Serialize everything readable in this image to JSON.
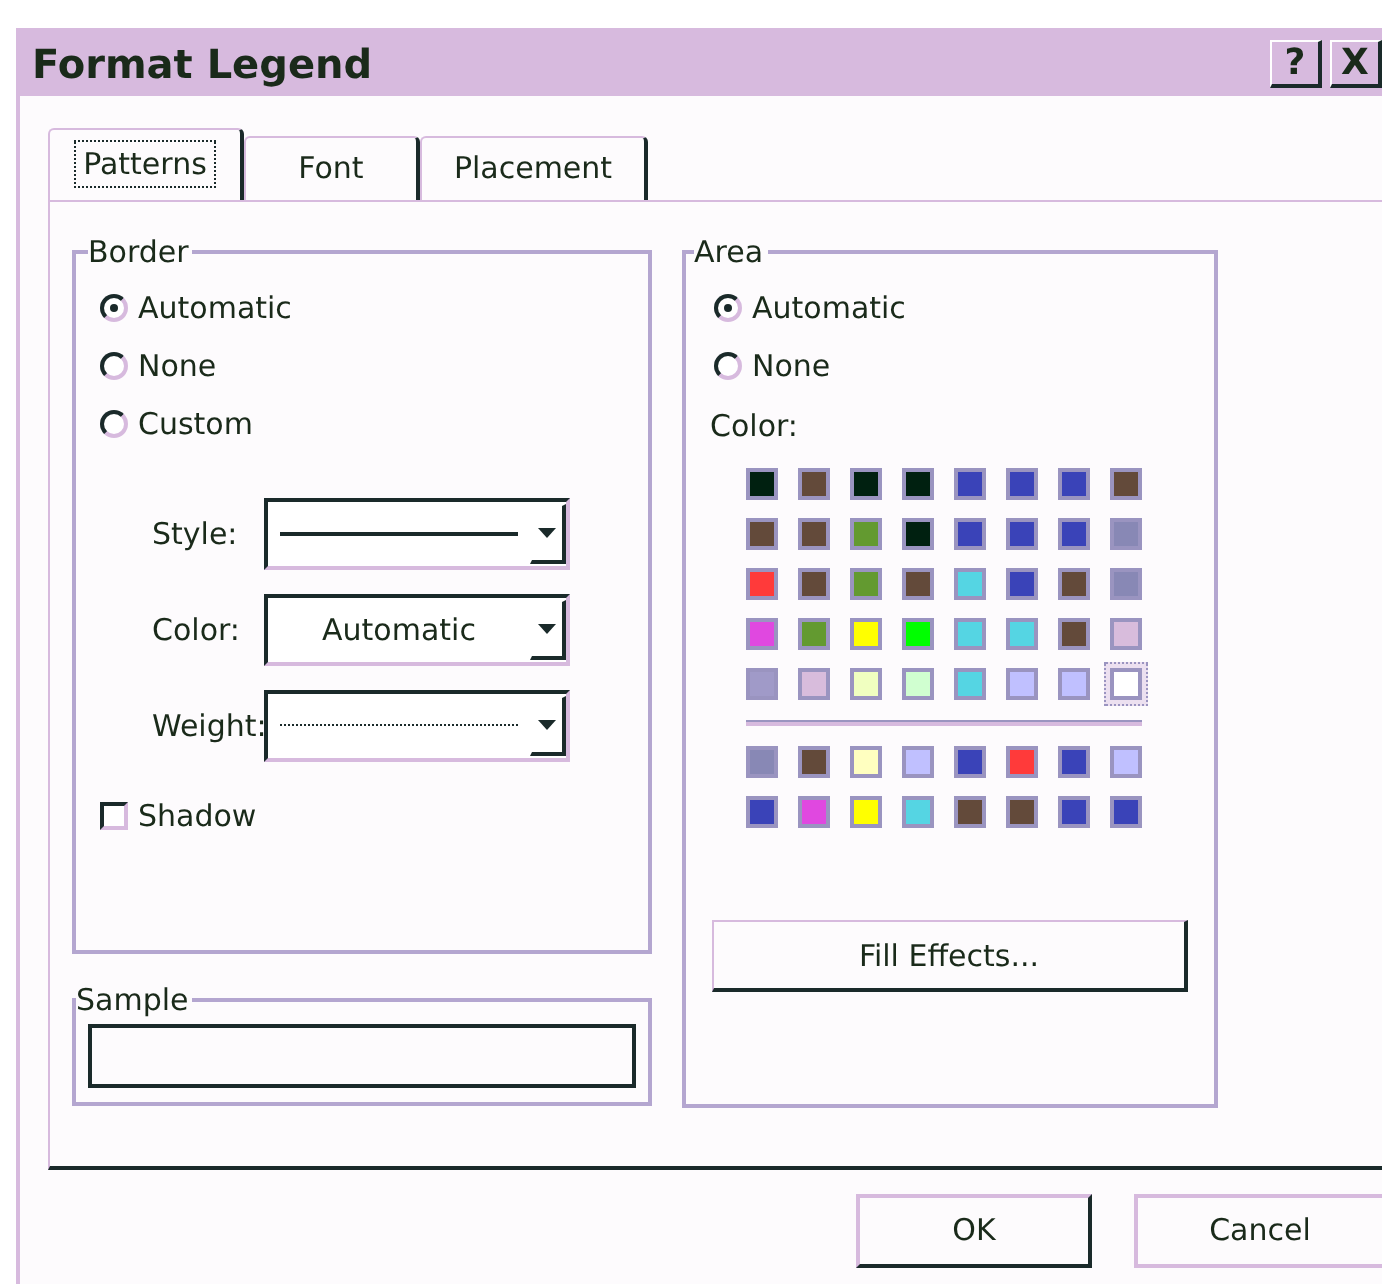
{
  "window": {
    "title": "Format Legend",
    "title_buttons": [
      "?",
      "X"
    ]
  },
  "tabs": [
    {
      "label": "Patterns",
      "selected": true
    },
    {
      "label": "Font",
      "selected": false
    },
    {
      "label": "Placement",
      "selected": false
    }
  ],
  "border": {
    "title": "Border",
    "options": [
      {
        "label": "Automatic",
        "selected": true
      },
      {
        "label": "None",
        "selected": false
      },
      {
        "label": "Custom",
        "selected": false
      }
    ],
    "fields": [
      {
        "label": "Style:",
        "kind": "line"
      },
      {
        "label": "Color:",
        "kind": "text",
        "value": "Automatic"
      },
      {
        "label": "Weight:",
        "kind": "dotted"
      }
    ],
    "shadow": {
      "label": "Shadow",
      "checked": false
    }
  },
  "sample": {
    "title": "Sample"
  },
  "area": {
    "title": "Area",
    "options": [
      {
        "label": "Automatic",
        "selected": true
      },
      {
        "label": "None",
        "selected": false
      }
    ],
    "color_label": "Color:",
    "colors": [
      [
        {
          "color": "#002010",
          "selected": false
        },
        {
          "color": "#634a3a",
          "selected": false
        },
        {
          "color": "#002010",
          "selected": false
        },
        {
          "color": "#002010",
          "selected": false
        },
        {
          "color": "#3a43b8",
          "selected": false
        },
        {
          "color": "#3a43b8",
          "selected": false
        },
        {
          "color": "#3a43b8",
          "selected": false
        },
        {
          "color": "#634a3a",
          "selected": false
        }
      ],
      [
        {
          "color": "#634a3a",
          "selected": false
        },
        {
          "color": "#634a3a",
          "selected": false
        },
        {
          "color": "#639a30",
          "selected": false
        },
        {
          "color": "#002010",
          "selected": false
        },
        {
          "color": "#3a43b8",
          "selected": false
        },
        {
          "color": "#3a43b8",
          "selected": false
        },
        {
          "color": "#3a43b8",
          "selected": false
        },
        {
          "color": "#8888b5",
          "selected": false
        }
      ],
      [
        {
          "color": "#ff3a3a",
          "selected": false
        },
        {
          "color": "#634a3a",
          "selected": false
        },
        {
          "color": "#639a30",
          "selected": false
        },
        {
          "color": "#634a3a",
          "selected": false
        },
        {
          "color": "#55d5e3",
          "selected": false
        },
        {
          "color": "#3a43b8",
          "selected": false
        },
        {
          "color": "#634a3a",
          "selected": false
        },
        {
          "color": "#8888b5",
          "selected": false
        }
      ],
      [
        {
          "color": "#e048e0",
          "selected": false
        },
        {
          "color": "#639a30",
          "selected": false
        },
        {
          "color": "#ffff00",
          "selected": false
        },
        {
          "color": "#00ff00",
          "selected": false
        },
        {
          "color": "#55d5e3",
          "selected": false
        },
        {
          "color": "#55d5e3",
          "selected": false
        },
        {
          "color": "#634a3a",
          "selected": false
        },
        {
          "color": "#d8bcdc",
          "selected": false
        }
      ],
      [
        {
          "color": "#a09ac8",
          "selected": false
        },
        {
          "color": "#d8bcdc",
          "selected": false
        },
        {
          "color": "#f0ffc0",
          "selected": false
        },
        {
          "color": "#d0ffd0",
          "selected": false
        },
        {
          "color": "#55d5e3",
          "selected": false
        },
        {
          "color": "#c0c0ff",
          "selected": false
        },
        {
          "color": "#c0c0ff",
          "selected": false
        },
        {
          "color": "#ffffff",
          "selected": true
        }
      ]
    ],
    "chart_colors": [
      [
        {
          "color": "#8888b5",
          "selected": false
        },
        {
          "color": "#634a3a",
          "selected": false
        },
        {
          "color": "#ffffc0",
          "selected": false
        },
        {
          "color": "#c0c0ff",
          "selected": false
        },
        {
          "color": "#3a43b8",
          "selected": false
        },
        {
          "color": "#ff3a3a",
          "selected": false
        },
        {
          "color": "#3a43b8",
          "selected": false
        },
        {
          "color": "#c0c0ff",
          "selected": false
        }
      ],
      [
        {
          "color": "#3a43b8",
          "selected": false
        },
        {
          "color": "#e048e0",
          "selected": false
        },
        {
          "color": "#ffff00",
          "selected": false
        },
        {
          "color": "#55d5e3",
          "selected": false
        },
        {
          "color": "#634a3a",
          "selected": false
        },
        {
          "color": "#634a3a",
          "selected": false
        },
        {
          "color": "#3a43b8",
          "selected": false
        },
        {
          "color": "#3a43b8",
          "selected": false
        }
      ]
    ],
    "fill_button": "Fill Effects..."
  },
  "buttons": [
    "OK",
    "Cancel"
  ]
}
